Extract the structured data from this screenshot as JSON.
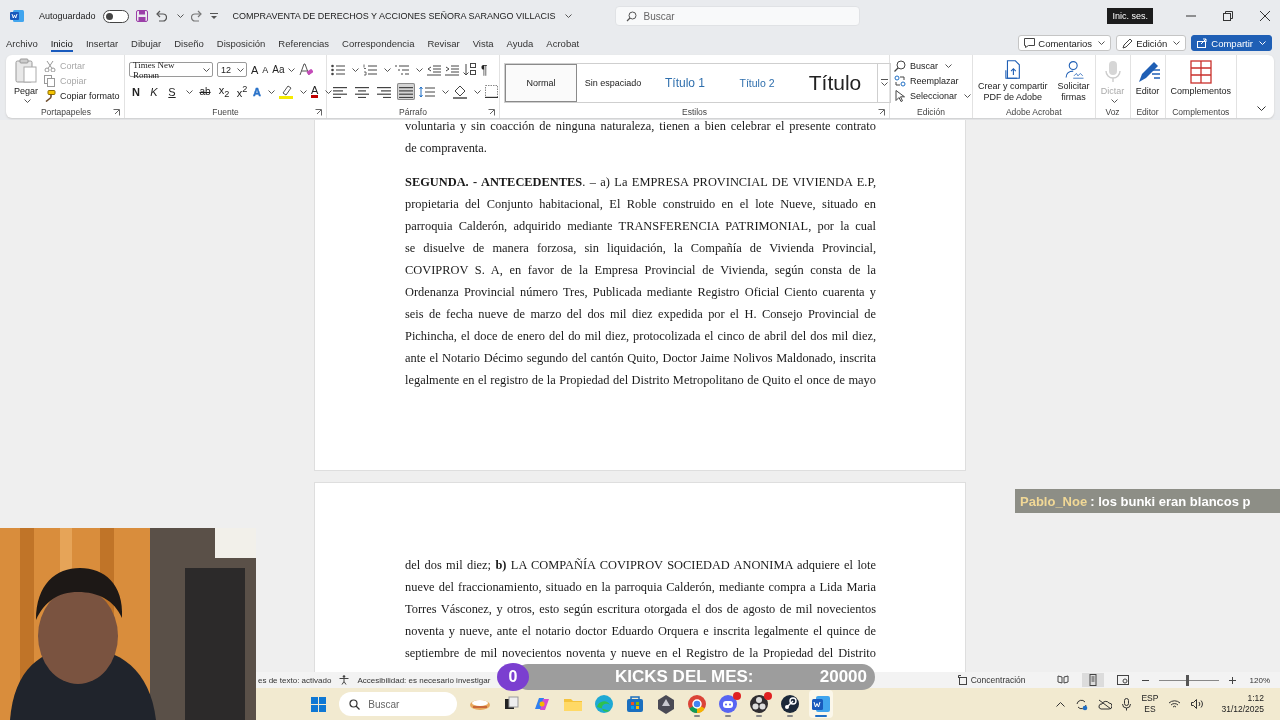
{
  "titlebar": {
    "autosave_label": "Autoguardado",
    "autosave_on": false,
    "title": "COMPRAVENTA DE DERECHOS Y ACCIONES SEÑORA SARANGO VILLACIS",
    "search_placeholder": "Buscar",
    "signin": "Inic. ses."
  },
  "tabs": [
    {
      "label": "Archivo",
      "selected": false
    },
    {
      "label": "Inicio",
      "selected": true
    },
    {
      "label": "Insertar",
      "selected": false
    },
    {
      "label": "Dibujar",
      "selected": false
    },
    {
      "label": "Diseño",
      "selected": false
    },
    {
      "label": "Disposición",
      "selected": false
    },
    {
      "label": "Referencias",
      "selected": false
    },
    {
      "label": "Correspondencia",
      "selected": false
    },
    {
      "label": "Revisar",
      "selected": false
    },
    {
      "label": "Vista",
      "selected": false
    },
    {
      "label": "Ayuda",
      "selected": false
    },
    {
      "label": "Acrobat",
      "selected": false
    }
  ],
  "header_buttons": [
    {
      "label": "Comentarios",
      "kind": "comments"
    },
    {
      "label": "Edición",
      "kind": "editing"
    },
    {
      "label": "Compartir",
      "kind": "share"
    }
  ],
  "ribbon": {
    "clipboard": {
      "label": "Portapapeles",
      "paste": "Pegar",
      "items": [
        {
          "label": "Cortar",
          "kind": "cut",
          "disabled": true
        },
        {
          "label": "Copiar",
          "kind": "copy",
          "disabled": true
        },
        {
          "label": "Copiar formato",
          "kind": "painter",
          "disabled": false
        }
      ]
    },
    "font": {
      "label": "Fuente",
      "name": "Times New Roman",
      "size": "12",
      "grow": "A",
      "shrink": "A",
      "case_button": "Aa",
      "effects": "A",
      "color_button": "A",
      "styles": [
        {
          "text": "N",
          "kind": "bold"
        },
        {
          "text": "K",
          "kind": "italic"
        },
        {
          "text": "S",
          "kind": "underline"
        },
        {
          "text": "ab",
          "kind": "strike"
        },
        {
          "text": "x$_{2}$",
          "kind": "sub"
        },
        {
          "text": "x$^{2}$",
          "kind": "sup"
        }
      ]
    },
    "paragraph": {
      "label": "Párrafo",
      "pilcrow": "¶",
      "alignment": [
        {
          "kind": "left",
          "selected": false
        },
        {
          "kind": "center",
          "selected": false
        },
        {
          "kind": "right",
          "selected": false
        },
        {
          "kind": "justify",
          "selected": true
        }
      ]
    },
    "styles": {
      "label": "Estilos",
      "items": [
        {
          "label": "Normal",
          "kind": "normal",
          "selected": true
        },
        {
          "label": "Sin espaciado",
          "kind": "nospace",
          "selected": false
        },
        {
          "label": "Título 1",
          "kind": "h1",
          "selected": false
        },
        {
          "label": "Título 2",
          "kind": "h2",
          "selected": false
        },
        {
          "label": "Título",
          "kind": "title",
          "selected": false
        }
      ]
    },
    "editing": {
      "label": "Edición",
      "items": [
        {
          "label": "Buscar",
          "kind": "find"
        },
        {
          "label": "Reemplazar",
          "kind": "replace"
        },
        {
          "label": "Seleccionar",
          "kind": "select"
        }
      ]
    },
    "big_groups": [
      {
        "label": "Adobe Acrobat",
        "buttons": [
          {
            "label": "Crear y compartir\nPDF de Adobe",
            "kind": "pdf",
            "disabled": false
          },
          {
            "label": "Solicitar\nfirmas",
            "kind": "sign",
            "disabled": false
          }
        ]
      },
      {
        "label": "Voz",
        "buttons": [
          {
            "label": "Dictar",
            "kind": "mic",
            "disabled": true
          }
        ]
      },
      {
        "label": "Editor",
        "buttons": [
          {
            "label": "Editor",
            "kind": "editor",
            "disabled": false
          }
        ]
      },
      {
        "label": "Complementos",
        "buttons": [
          {
            "label": "Complementos",
            "kind": "addins",
            "disabled": false
          }
        ]
      }
    ]
  },
  "pages": [
    {
      "paragraphs": [
        {
          "continues": false,
          "lines": [
            "voluntaria y sin coacción de ninguna naturaleza, tienen a bien celebrar el presente contrato",
            "de compraventa."
          ]
        },
        {
          "continues": true,
          "lines": [
            "**SEGUNDA. - ANTECEDENTES**. – a) La EMPRESA PROVINCIAL DE VIVIENDA E.P,",
            "propietaria del Conjunto habitacional, El Roble construido en el lote Nueve, situado en",
            "parroquia Calderón, adquirido mediante TRANSFERENCIA PATRIMONIAL, por la cual",
            "se disuelve de manera forzosa, sin liquidación, la Compañía de Vivienda Provincial,",
            "COVIPROV S. A, en favor de la Empresa Provincial de Vivienda, según consta de la",
            "Ordenanza Provincial número Tres, Publicada mediante Registro Oficial Ciento cuarenta y",
            "seis de fecha nueve de marzo del dos mil diez expedida por el H. Consejo Provincial de",
            "Pichincha, el doce de enero del do mil diez, protocolizada el cinco de abril del dos mil diez,",
            "ante el Notario Décimo segundo del cantón Quito, Doctor Jaime Nolivos Maldonado, inscrita",
            "legalmente en el registro de la Propiedad del Distrito Metropolitano de Quito el once de mayo"
          ]
        }
      ]
    },
    {
      "paragraphs": [
        {
          "continues": true,
          "lines": [
            "del dos mil diez; **b)** LA COMPAÑÍA COVIPROV SOCIEDAD ANONIMA adquiere el lote",
            "nueve del fraccionamiento, situado en la parroquia Calderón, mediante compra a Lida Maria",
            "Torres Vásconez, y otros, esto según escritura otorgada el dos de agosto de mil novecientos",
            "noventa y nueve, ante el notario doctor Eduardo Orquera e inscrita legalmente el quince de",
            "septiembre de mil novecientos noventa y nueve en el Registro de la Propiedad del Distrito"
          ]
        }
      ]
    }
  ],
  "status_bar": {
    "items": [
      {
        "text": "es de texto: activado",
        "kind": "plain"
      },
      {
        "text": "Accesibilidad: es necesario investigar",
        "kind": "accessibility"
      }
    ],
    "focus": "Concentración",
    "views": [
      {
        "kind": "read",
        "selected": false
      },
      {
        "kind": "print",
        "selected": true
      },
      {
        "kind": "web",
        "selected": false
      }
    ],
    "zoom": {
      "level": 0.47,
      "reading": "120%"
    }
  },
  "taskbar": {
    "search_placeholder": "Buscar",
    "apps": [
      {
        "kind": "widget",
        "running": false,
        "active": false,
        "notification": false
      },
      {
        "kind": "taskview",
        "running": false,
        "active": false,
        "notification": false
      },
      {
        "kind": "assistant",
        "running": false,
        "active": false,
        "notification": false
      },
      {
        "kind": "folder",
        "running": false,
        "active": false,
        "notification": false
      },
      {
        "kind": "edge",
        "running": false,
        "active": false,
        "notification": false
      },
      {
        "kind": "store",
        "running": false,
        "active": false,
        "notification": false
      },
      {
        "kind": "hexagon",
        "running": false,
        "active": false,
        "notification": false
      },
      {
        "kind": "chrome",
        "running": true,
        "active": false,
        "notification": false
      },
      {
        "kind": "chat",
        "running": true,
        "active": false,
        "notification": true
      },
      {
        "kind": "recorder",
        "running": true,
        "active": false,
        "notification": true
      },
      {
        "kind": "steam",
        "running": true,
        "active": false,
        "notification": false
      },
      {
        "kind": "word",
        "running": true,
        "active": true,
        "notification": false
      }
    ],
    "tray": {
      "language": "ESP",
      "layout": "ES",
      "time": "1:12",
      "date": "31/12/2025"
    }
  },
  "overlays": {
    "kicks": {
      "count": "0",
      "label": "KICKS DEL MES:",
      "goal": "20000"
    },
    "chat": {
      "user": "Pablo_Noe",
      "message": ": los bunki eran blancos p"
    }
  }
}
